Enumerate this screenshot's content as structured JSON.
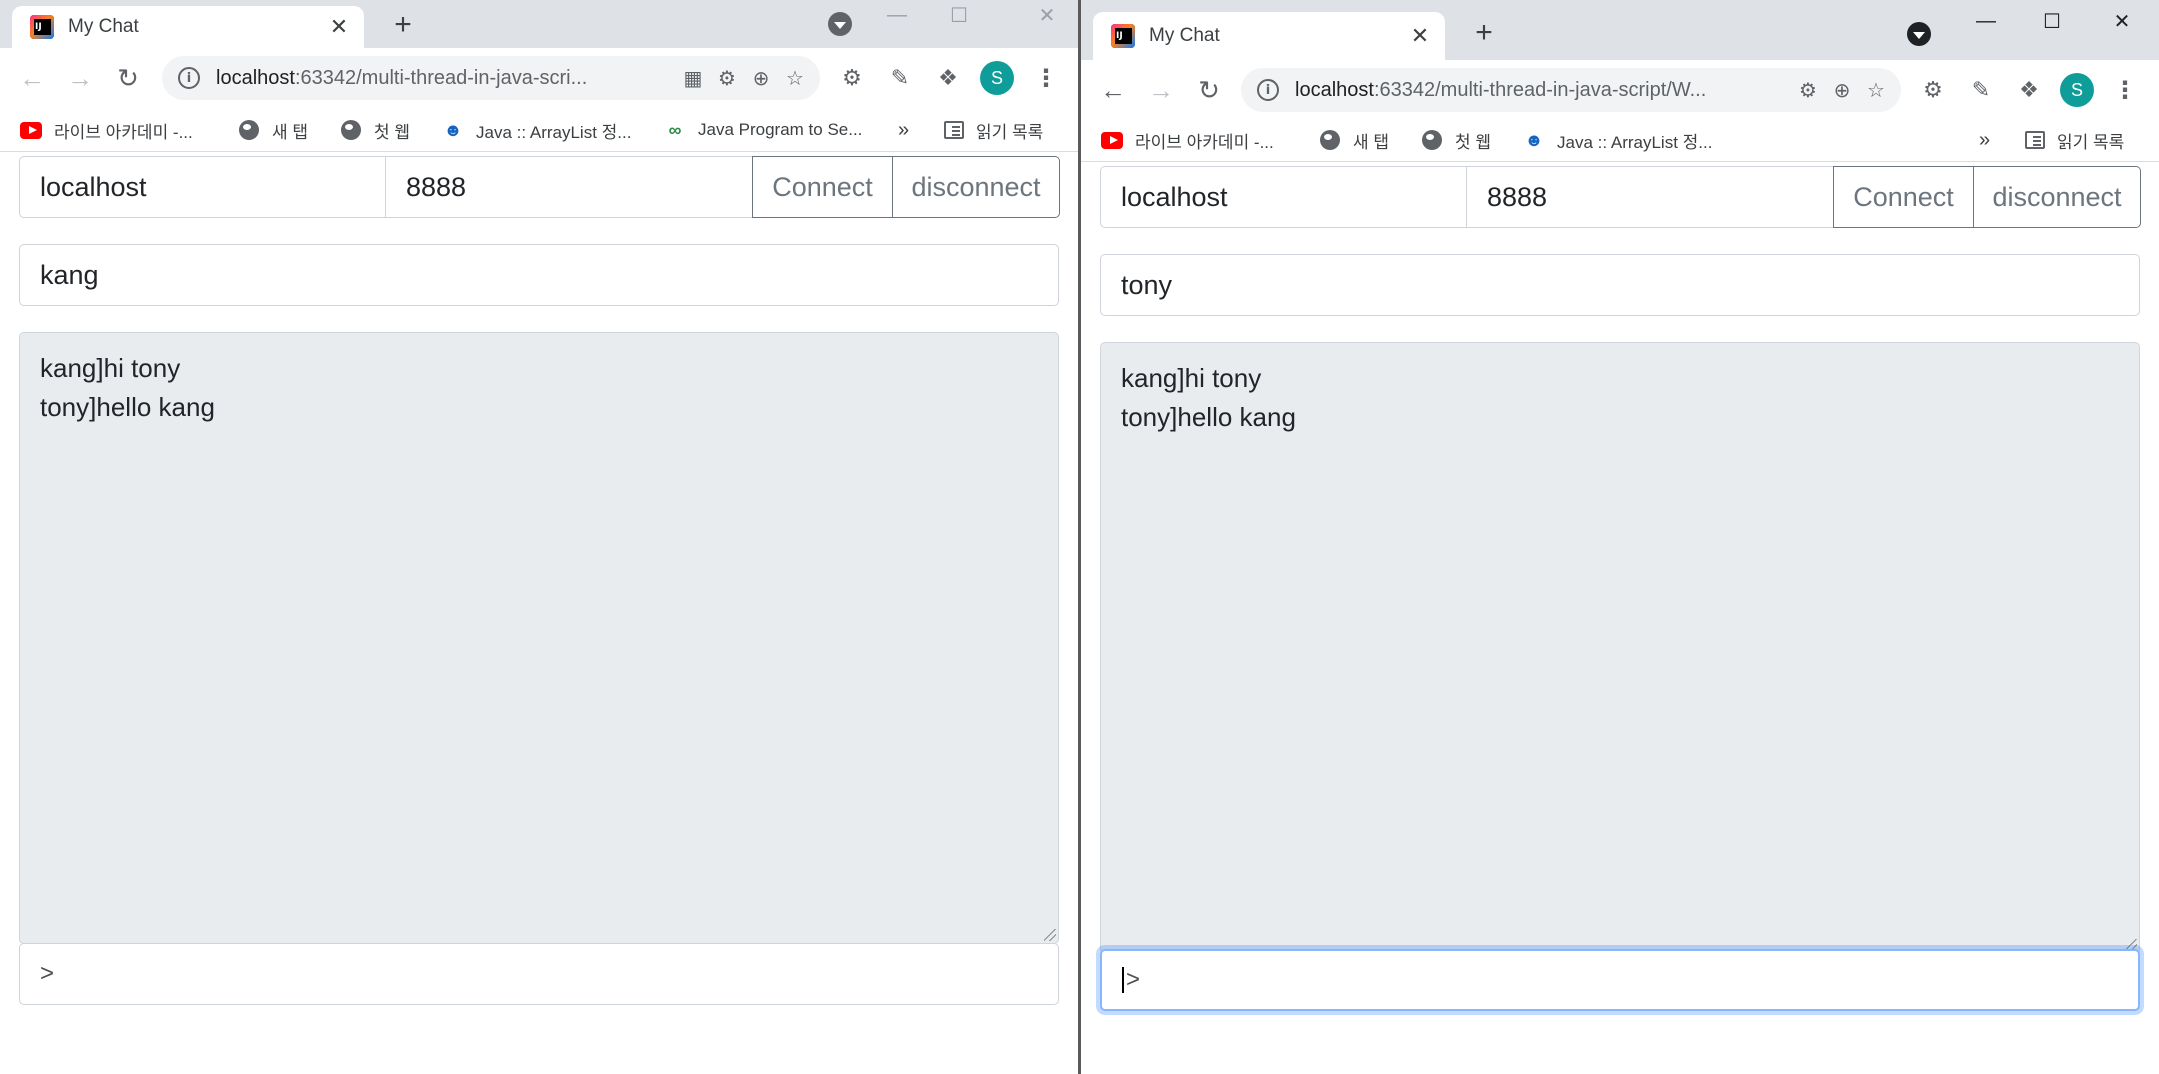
{
  "colors": {
    "tabstrip": "#dee1e6",
    "chatlog_bg": "#e9ecef",
    "avatar": "#0f9d9a",
    "button_border": "#6c757d",
    "focus_ring": "#86b7fe"
  },
  "windows": [
    {
      "tab": {
        "title": "My Chat",
        "icon": "intellij-icon"
      },
      "url": {
        "host": "localhost",
        "rest": ":63342/multi-thread-in-java-scri..."
      },
      "avatar_initial": "S",
      "bookmarks": [
        {
          "label": "라이브 아카데미 -...",
          "icon": "youtube-icon"
        },
        {
          "label": "새 탭",
          "icon": "globe-icon"
        },
        {
          "label": "첫 웹",
          "icon": "globe-icon"
        },
        {
          "label": "Java :: ArrayList 정...",
          "icon": "character-icon"
        },
        {
          "label": "Java Program to Se...",
          "icon": "geeks-icon"
        }
      ],
      "reading_list": "읽기 목록",
      "form": {
        "host": "localhost",
        "port": "8888",
        "connect_label": "Connect",
        "disconnect_label": "disconnect",
        "username": "kang",
        "messages": [
          "kang]hi tony",
          "tony]hello kang"
        ],
        "input_value": ">"
      }
    },
    {
      "tab": {
        "title": "My Chat",
        "icon": "intellij-icon"
      },
      "url": {
        "host": "localhost",
        "rest": ":63342/multi-thread-in-java-script/W..."
      },
      "avatar_initial": "S",
      "bookmarks": [
        {
          "label": "라이브 아카데미 -...",
          "icon": "youtube-icon"
        },
        {
          "label": "새 탭",
          "icon": "globe-icon"
        },
        {
          "label": "첫 웹",
          "icon": "globe-icon"
        },
        {
          "label": "Java :: ArrayList 정...",
          "icon": "character-icon"
        }
      ],
      "reading_list": "읽기 목록",
      "form": {
        "host": "localhost",
        "port": "8888",
        "connect_label": "Connect",
        "disconnect_label": "disconnect",
        "username": "tony",
        "messages": [
          "kang]hi tony",
          "tony]hello kang"
        ],
        "input_value": ">"
      }
    }
  ],
  "glyphs": {
    "close": "✕",
    "plus": "+",
    "overflow": "»"
  }
}
